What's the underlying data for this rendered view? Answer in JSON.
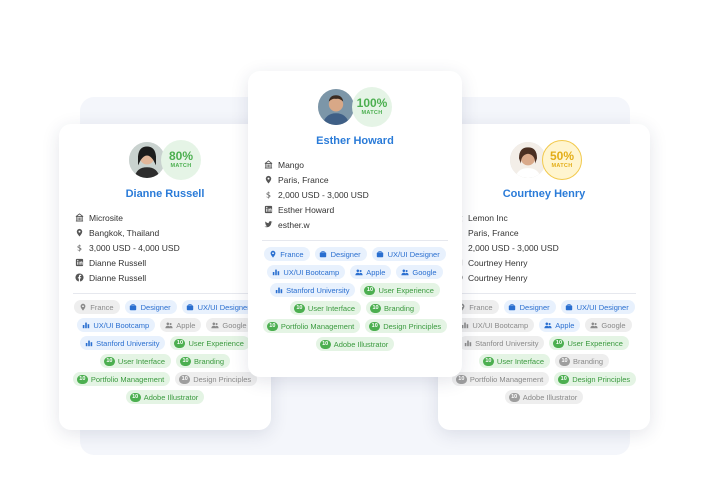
{
  "cards": {
    "left": {
      "name": "Dianne Russell",
      "match_pct": "80%",
      "match_label": "MATCH",
      "details": [
        "Microsite",
        "Bangkok, Thailand",
        "3,000 USD - 4,000 USD",
        "Dianne Russell",
        "Dianne Russell"
      ],
      "detail_icons": [
        "building-icon",
        "pin-icon",
        "dollar-icon",
        "linkedin-icon",
        "facebook-icon"
      ],
      "chips": [
        {
          "label": "France",
          "style": "grey",
          "icon": "pin-icon"
        },
        {
          "label": "Designer",
          "style": "blue",
          "icon": "briefcase-icon"
        },
        {
          "label": "UX/UI Designer",
          "style": "blue",
          "icon": "briefcase-icon"
        },
        {
          "label": "UX/UI Bootcamp",
          "style": "blue",
          "icon": "chart-icon"
        },
        {
          "label": "Apple",
          "style": "grey",
          "icon": "people-icon"
        },
        {
          "label": "Google",
          "style": "grey",
          "icon": "people-icon"
        },
        {
          "label": "Stanford University",
          "style": "blue",
          "icon": "chart-icon"
        },
        {
          "label": "User Experience",
          "style": "green",
          "num": "10"
        },
        {
          "label": "User Interface",
          "style": "green",
          "num": "10"
        },
        {
          "label": "Branding",
          "style": "green",
          "num": "10"
        },
        {
          "label": "Portfolio Management",
          "style": "green",
          "num": "10"
        },
        {
          "label": "Design Principles",
          "style": "greyskill",
          "num": "10"
        },
        {
          "label": "Adobe Illustrator",
          "style": "green",
          "num": "10"
        }
      ]
    },
    "center": {
      "name": "Esther Howard",
      "match_pct": "100%",
      "match_label": "MATCH",
      "details": [
        "Mango",
        "Paris, France",
        "2,000 USD - 3,000 USD",
        "Esther Howard",
        "esther.w"
      ],
      "detail_icons": [
        "building-icon",
        "pin-icon",
        "dollar-icon",
        "linkedin-icon",
        "twitter-icon"
      ],
      "chips": [
        {
          "label": "France",
          "style": "blue",
          "icon": "pin-icon"
        },
        {
          "label": "Designer",
          "style": "blue",
          "icon": "briefcase-icon"
        },
        {
          "label": "UX/UI Designer",
          "style": "blue",
          "icon": "briefcase-icon"
        },
        {
          "label": "UX/UI Bootcamp",
          "style": "blue",
          "icon": "chart-icon"
        },
        {
          "label": "Apple",
          "style": "blue",
          "icon": "people-icon"
        },
        {
          "label": "Google",
          "style": "blue",
          "icon": "people-icon"
        },
        {
          "label": "Stanford University",
          "style": "blue",
          "icon": "chart-icon"
        },
        {
          "label": "User Experience",
          "style": "green",
          "num": "10"
        },
        {
          "label": "User Interface",
          "style": "green",
          "num": "10"
        },
        {
          "label": "Branding",
          "style": "green",
          "num": "10"
        },
        {
          "label": "Portfolio Management",
          "style": "green",
          "num": "10"
        },
        {
          "label": "Design Principles",
          "style": "green",
          "num": "10"
        },
        {
          "label": "Adobe Illustrator",
          "style": "green",
          "num": "10"
        }
      ]
    },
    "right": {
      "name": "Courtney Henry",
      "match_pct": "50%",
      "match_label": "MATCH",
      "details": [
        "Lemon Inc",
        "Paris, France",
        "2,000 USD - 3,000 USD",
        "Courtney Henry",
        "Courtney Henry"
      ],
      "detail_icons": [
        "building-icon",
        "pin-icon",
        "dollar-icon",
        "linkedin-icon",
        "facebook-icon"
      ],
      "chips": [
        {
          "label": "France",
          "style": "grey",
          "icon": "pin-icon"
        },
        {
          "label": "Designer",
          "style": "blue",
          "icon": "briefcase-icon"
        },
        {
          "label": "UX/UI Designer",
          "style": "blue",
          "icon": "briefcase-icon"
        },
        {
          "label": "UX/UI Bootcamp",
          "style": "grey",
          "icon": "chart-icon"
        },
        {
          "label": "Apple",
          "style": "blue",
          "icon": "people-icon"
        },
        {
          "label": "Google",
          "style": "grey",
          "icon": "people-icon"
        },
        {
          "label": "Stanford University",
          "style": "grey",
          "icon": "chart-icon"
        },
        {
          "label": "User Experience",
          "style": "green",
          "num": "10"
        },
        {
          "label": "User Interface",
          "style": "green",
          "num": "10"
        },
        {
          "label": "Branding",
          "style": "greyskill",
          "num": "10"
        },
        {
          "label": "Portfolio Management",
          "style": "greyskill",
          "num": "10"
        },
        {
          "label": "Design Principles",
          "style": "green",
          "num": "10"
        },
        {
          "label": "Adobe Illustrator",
          "style": "greyskill",
          "num": "10"
        }
      ]
    }
  },
  "colors": {
    "name_blue": "#2a7bd8",
    "match_green": "#4caf50",
    "match_yellow": "#e3ad17"
  }
}
